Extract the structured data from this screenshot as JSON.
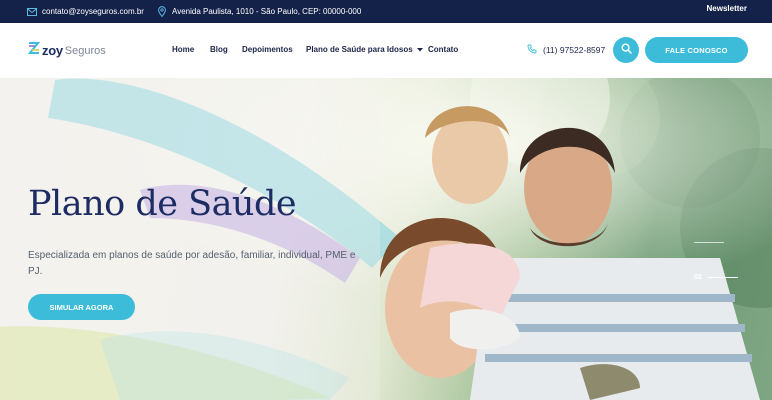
{
  "topbar": {
    "email": "contato@zoyseguros.com.br",
    "address": "Avenida Paulista, 1010 - São Paulo, CEP: 00000-000",
    "newsletter": "Newsletter",
    "email_icon": "envelope-icon",
    "address_icon": "map-pin-icon"
  },
  "header": {
    "logo_brand": "zoy",
    "logo_suffix": "Seguros",
    "nav": [
      "Home",
      "Blog",
      "Depoimentos",
      "Plano de Saúde para Idosos",
      "Contato"
    ],
    "phone": "(11) 97522-8597",
    "cta": "FALE CONOSCO"
  },
  "hero": {
    "title": "Plano de Saúde",
    "subtitle": "Especializada em planos de saúde por adesão, familiar, individual, PME e PJ.",
    "button": "SIMULAR AGORA",
    "slide_current": "02"
  },
  "colors": {
    "navy": "#14224a",
    "accent": "#3dbcd9",
    "title": "#1d2c63"
  }
}
